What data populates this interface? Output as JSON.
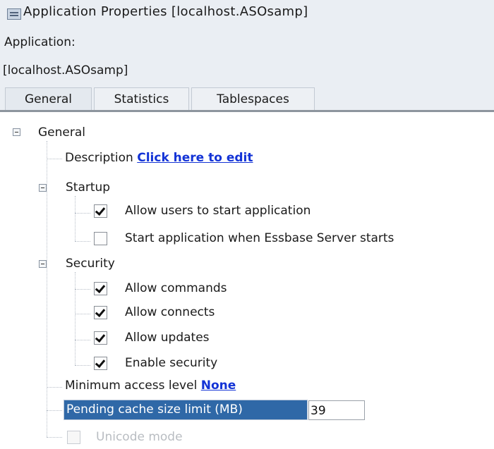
{
  "window": {
    "title": "Application Properties [localhost.ASOsamp]"
  },
  "header": {
    "application_label": "Application:",
    "application_name": "[localhost.ASOsamp]"
  },
  "tabs": [
    {
      "label": "General",
      "active": true
    },
    {
      "label": "Statistics",
      "active": false
    },
    {
      "label": "Tablespaces",
      "active": false
    }
  ],
  "tree": {
    "general_label": "General",
    "description": {
      "label": "Description",
      "link_text": "Click here to edit"
    },
    "startup": {
      "label": "Startup",
      "allow_users_start": {
        "label": "Allow users to start application",
        "checked": true
      },
      "start_with_server": {
        "label": "Start application when Essbase Server starts",
        "checked": false
      }
    },
    "security": {
      "label": "Security",
      "allow_commands": {
        "label": "Allow commands",
        "checked": true
      },
      "allow_connects": {
        "label": "Allow connects",
        "checked": true
      },
      "allow_updates": {
        "label": "Allow updates",
        "checked": true
      },
      "enable_security": {
        "label": "Enable security",
        "checked": true
      }
    },
    "minimum_access": {
      "label": "Minimum access level",
      "link_text": "None"
    },
    "pending_cache": {
      "label": "Pending cache size limit (MB)",
      "value": "39"
    },
    "unicode_mode": {
      "label": "Unicode mode",
      "checked": false,
      "disabled": true
    }
  },
  "icons": {
    "window_icon": "window-icon",
    "expanded_toggle": "collapse-icon"
  },
  "colors": {
    "link": "#1333d6",
    "selection": "#2f68a7",
    "panel": "#eaeef3"
  }
}
